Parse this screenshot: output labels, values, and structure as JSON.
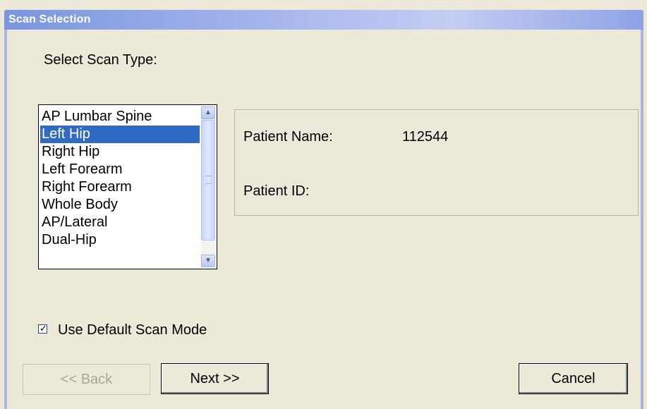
{
  "window": {
    "title": "Scan Selection"
  },
  "prompt": "Select Scan Type:",
  "scan_types": {
    "items": [
      "AP Lumbar Spine",
      "Left Hip",
      "Right Hip",
      "Left Forearm",
      "Right Forearm",
      "Whole Body",
      "AP/Lateral",
      "Dual-Hip"
    ],
    "selected": "Left Hip"
  },
  "patient": {
    "name_label": "Patient Name:",
    "name_value": "112544",
    "id_label": "Patient ID:",
    "id_value": ""
  },
  "options": {
    "default_scan_mode_label": "Use Default Scan Mode",
    "default_scan_mode_checked": true
  },
  "buttons": {
    "back": "<< Back",
    "next": "Next >>",
    "cancel": "Cancel"
  },
  "colors": {
    "title_bar": "#7a96df",
    "selection": "#316ac5",
    "dialog_bg": "#ece9d8"
  }
}
